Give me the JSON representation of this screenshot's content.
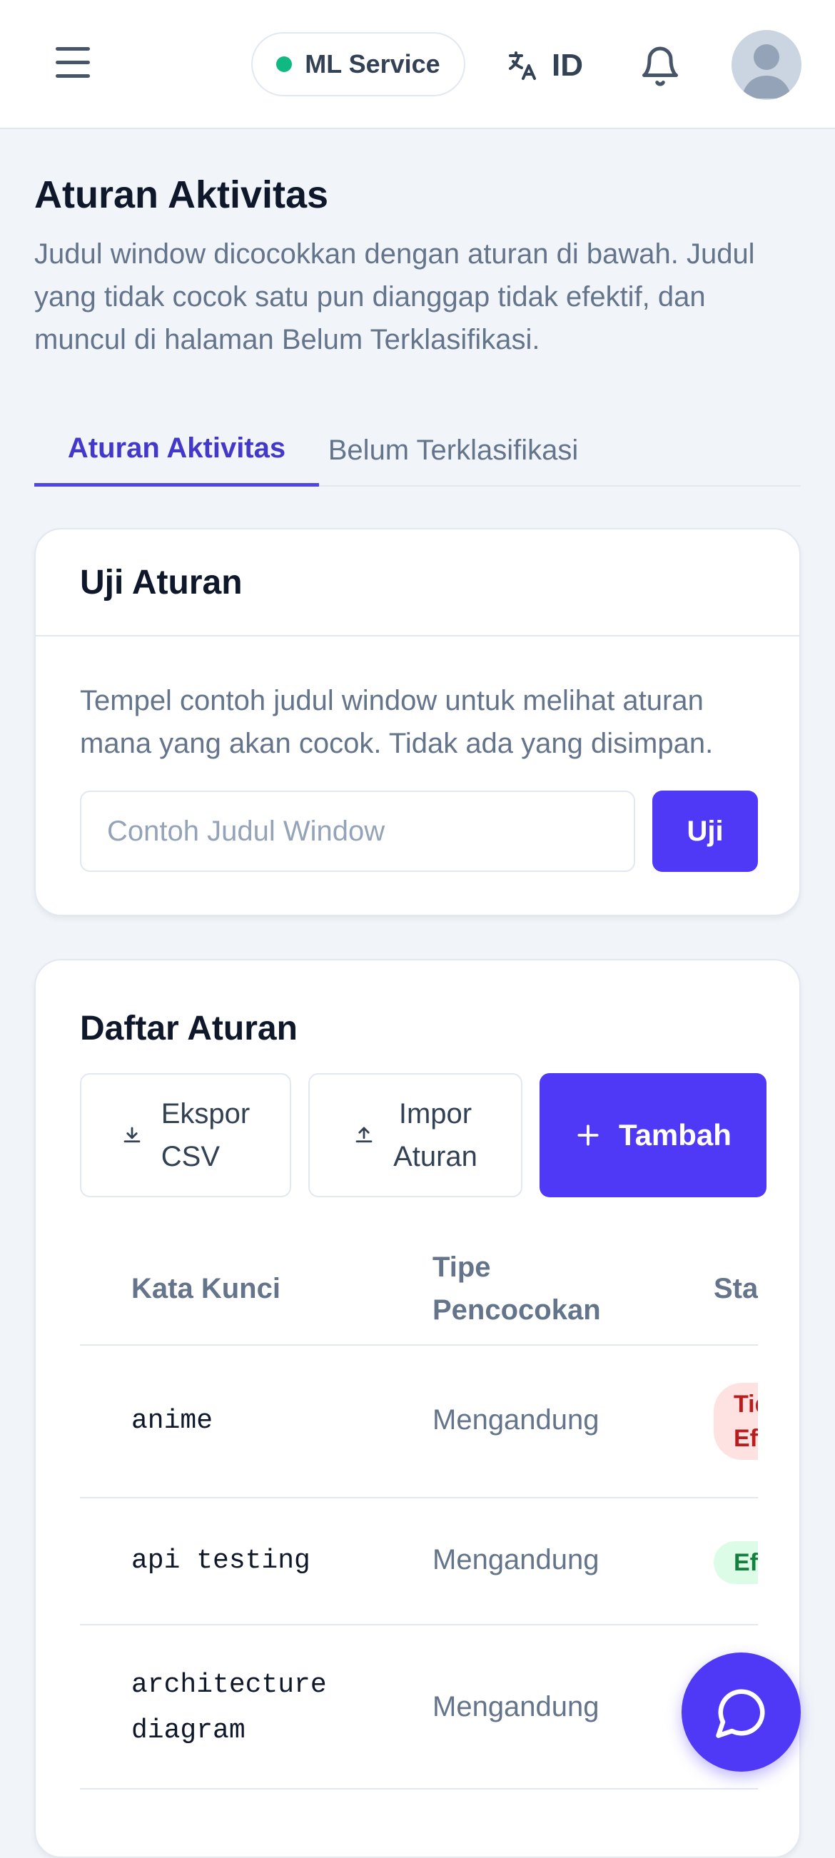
{
  "header": {
    "ml_service_label": "ML Service",
    "ml_status_color": "#10b981",
    "language_code": "ID"
  },
  "page": {
    "title": "Aturan Aktivitas",
    "description": "Judul window dicocokkan dengan aturan di bawah. Judul yang tidak cocok satu pun dianggap tidak efektif, dan muncul di halaman Belum Terklasifikasi."
  },
  "tabs": [
    {
      "label": "Aturan Aktivitas",
      "active": true
    },
    {
      "label": "Belum Terklasifikasi",
      "active": false
    }
  ],
  "test_card": {
    "title": "Uji Aturan",
    "help": "Tempel contoh judul window untuk melihat aturan mana yang akan cocok. Tidak ada yang disimpan.",
    "input_placeholder": "Contoh Judul Window",
    "input_value": "",
    "button_label": "Uji"
  },
  "rules_card": {
    "title": "Daftar Aturan",
    "export_line1": "Ekspor",
    "export_line2": "CSV",
    "import_line1": "Impor",
    "import_line2": "Aturan",
    "add_label": "Tambah",
    "columns": {
      "keyword": "Kata Kunci",
      "match_type_line1": "Tipe",
      "match_type_line2": "Pencocokan",
      "status": "Status"
    },
    "rows": [
      {
        "keyword_line1": "anime",
        "keyword_line2": "",
        "match_type": "Mengandung",
        "status_line1": "Tidak",
        "status_line2": "Efektif",
        "status_kind": "ineffective"
      },
      {
        "keyword_line1": "api testing",
        "keyword_line2": "",
        "match_type": "Mengandung",
        "status_line1": "Efektif",
        "status_line2": "",
        "status_kind": "effective"
      },
      {
        "keyword_line1": "architecture",
        "keyword_line2": "diagram",
        "match_type": "Mengandung",
        "status_line1": "",
        "status_line2": "",
        "status_kind": "hidden"
      }
    ]
  },
  "colors": {
    "accent": "#4f39f6",
    "tab_active": "#4338ca",
    "badge_ineffective_bg": "#fee2e2",
    "badge_ineffective_text": "#b91c1c",
    "badge_effective_bg": "#dcfce7",
    "badge_effective_text": "#15803d"
  },
  "icons": {
    "menu": "hamburger-icon",
    "translate": "translate-icon",
    "notifications": "bell-icon",
    "avatar": "user-avatar-icon",
    "export": "download-icon",
    "import": "upload-icon",
    "add": "plus-icon",
    "chat": "chat-bubble-icon"
  }
}
